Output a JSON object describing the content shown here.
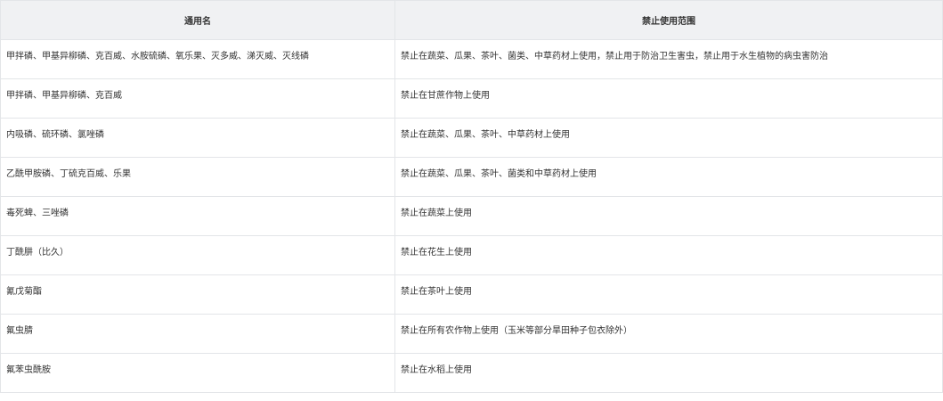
{
  "table": {
    "headers": [
      "通用名",
      "禁止使用范围"
    ],
    "rows": [
      [
        "甲拌磷、甲基异柳磷、克百威、水胺硫磷、氧乐果、灭多威、涕灭威、灭线磷",
        "禁止在蔬菜、瓜果、茶叶、菌类、中草药材上使用，禁止用于防治卫生害虫，禁止用于水生植物的病虫害防治"
      ],
      [
        "甲拌磷、甲基异柳磷、克百威",
        "禁止在甘蔗作物上使用"
      ],
      [
        "内吸磷、硫环磷、氯唑磷",
        "禁止在蔬菜、瓜果、茶叶、中草药材上使用"
      ],
      [
        "乙酰甲胺磷、丁硫克百威、乐果",
        "禁止在蔬菜、瓜果、茶叶、菌类和中草药材上使用"
      ],
      [
        "毒死蜱、三唑磷",
        "禁止在蔬菜上使用"
      ],
      [
        "丁酰肼（比久）",
        "禁止在花生上使用"
      ],
      [
        "氰戊菊酯",
        "禁止在茶叶上使用"
      ],
      [
        "氟虫腈",
        "禁止在所有农作物上使用（玉米等部分旱田种子包衣除外）"
      ],
      [
        "氟苯虫酰胺",
        "禁止在水稻上使用"
      ]
    ]
  }
}
